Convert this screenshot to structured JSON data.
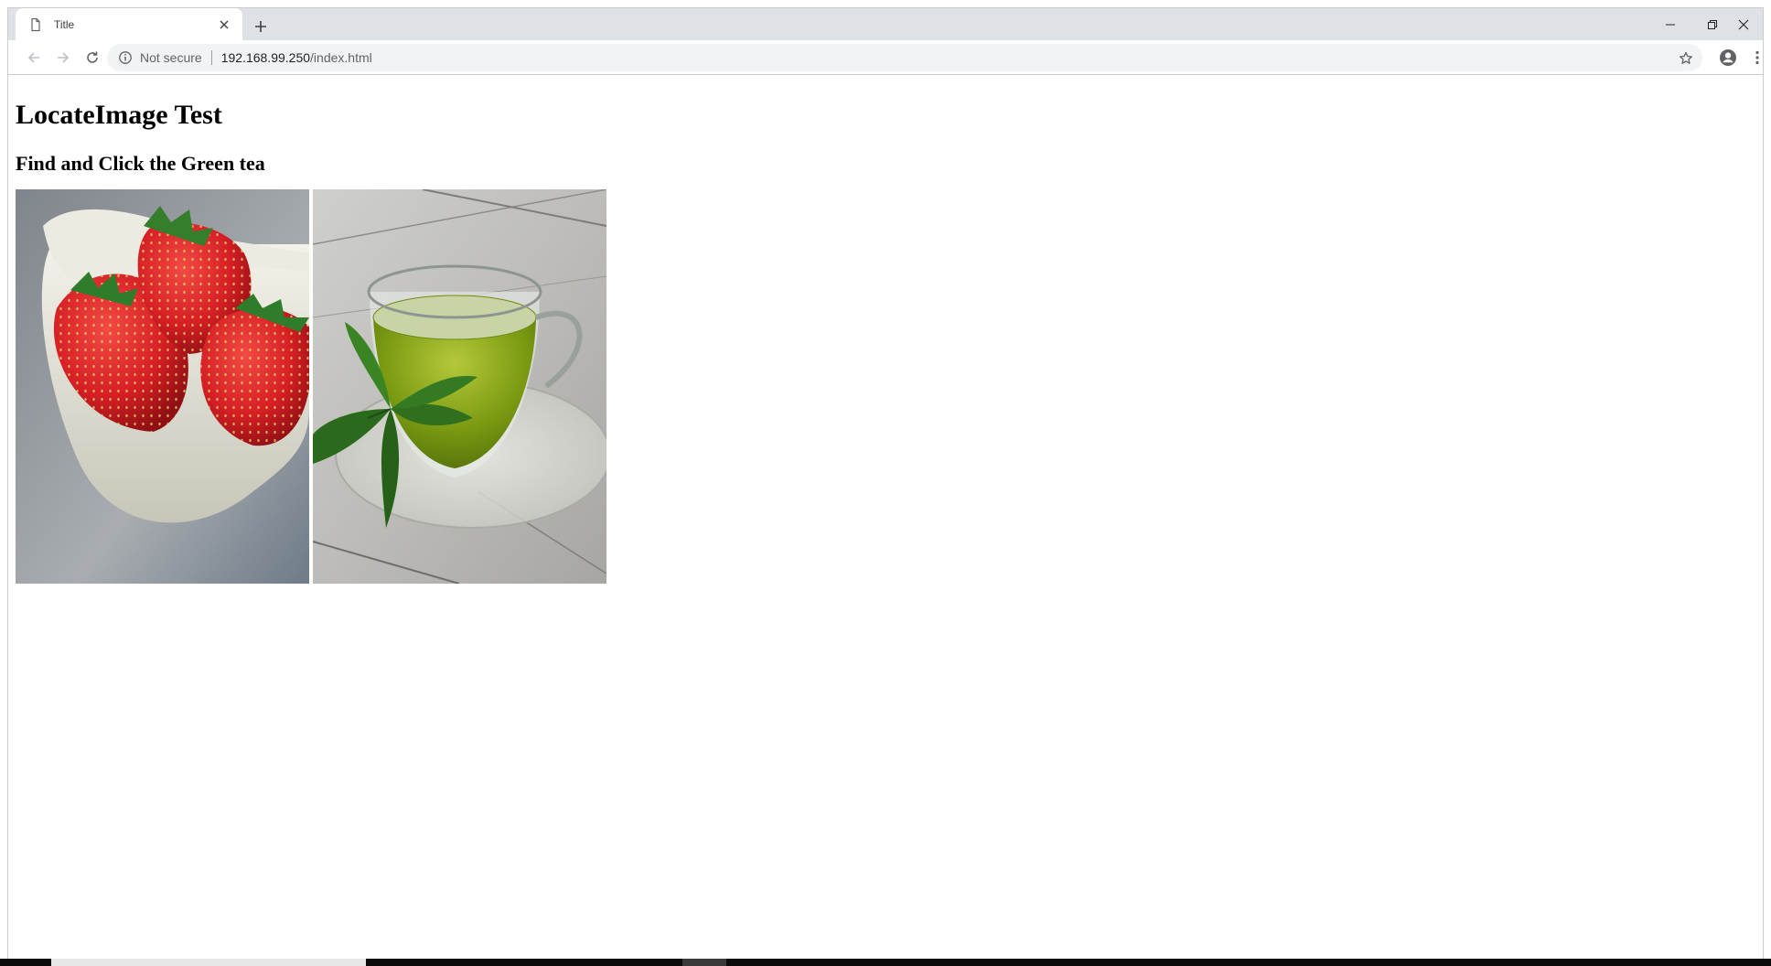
{
  "browser": {
    "tab_title": "Title",
    "url_security_text": "Not secure",
    "url_host": "192.168.99.250",
    "url_path": "/index.html"
  },
  "page": {
    "heading": "LocateImage Test",
    "subheading": "Find and Click the Green tea",
    "images": [
      {
        "name": "strawberries"
      },
      {
        "name": "green tea"
      }
    ]
  },
  "colors": {
    "tabstrip_bg": "#dee1e6",
    "omnibox_bg": "#f1f3f4",
    "tea_green": "#7a9a12",
    "strawberry_red": "#d8232a"
  },
  "icons": [
    "page-icon",
    "close-icon",
    "plus-icon",
    "minimize-icon",
    "restore-icon",
    "back-icon",
    "forward-icon",
    "reload-icon",
    "info-icon",
    "star-icon",
    "account-icon",
    "menu-icon"
  ]
}
